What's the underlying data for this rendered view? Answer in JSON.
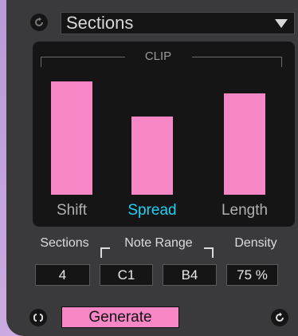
{
  "header": {
    "preset_label": "Sections"
  },
  "clip": {
    "title": "CLIP",
    "bars": [
      {
        "label": "Shift",
        "level": 0.78,
        "active": false
      },
      {
        "label": "Spread",
        "level": 0.54,
        "active": true
      },
      {
        "label": "Length",
        "level": 0.7,
        "active": false
      }
    ]
  },
  "params": {
    "sections_label": "Sections",
    "note_range_label": "Note Range",
    "density_label": "Density",
    "sections_value": "4",
    "note_low": "C1",
    "note_high": "B4",
    "density_value": "75 %"
  },
  "footer": {
    "generate_label": "Generate"
  },
  "colors": {
    "accent_pink": "#f786c7",
    "active_cyan": "#1fd0f0",
    "panel_bg": "#3a3a3c",
    "display_bg": "#151515"
  },
  "icons": {
    "reset": "reset-icon",
    "dropdown": "chevron-down-icon",
    "loop": "loop-icon",
    "redo": "redo-icon"
  }
}
